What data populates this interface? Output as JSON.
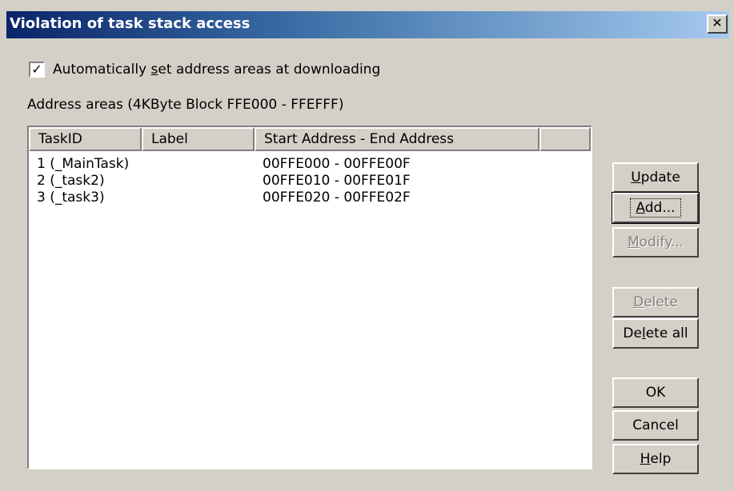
{
  "dialog": {
    "title": "Violation of task stack access",
    "close_glyph": "✕"
  },
  "auto_set": {
    "checked": true,
    "check_glyph": "✓",
    "label_pre": "Automatically ",
    "label_key": "s",
    "label_post": "et address areas at downloading"
  },
  "address_areas_label": "Address areas (4KByte Block  FFE000 - FFEFFF)",
  "table": {
    "columns": [
      "TaskID",
      "Label",
      "Start Address - End Address",
      ""
    ],
    "rows": [
      {
        "task_id": "1 (_MainTask)",
        "label": "",
        "range": "00FFE000 - 00FFE00F"
      },
      {
        "task_id": "2 (_task2)",
        "label": "",
        "range": "00FFE010 - 00FFE01F"
      },
      {
        "task_id": "3 (_task3)",
        "label": "",
        "range": "00FFE020 - 00FFE02F"
      }
    ]
  },
  "buttons": {
    "update": {
      "pre": "",
      "key": "U",
      "post": "pdate",
      "enabled": true
    },
    "add": {
      "pre": "",
      "key": "A",
      "post": "dd...",
      "enabled": true
    },
    "modify": {
      "pre": "",
      "key": "M",
      "post": "odify...",
      "enabled": false
    },
    "delete": {
      "pre": "",
      "key": "D",
      "post": "elete",
      "enabled": false
    },
    "delete_all": {
      "pre": "De",
      "key": "l",
      "post": "ete all",
      "enabled": true
    },
    "ok": {
      "label": "OK",
      "enabled": true
    },
    "cancel": {
      "label": "Cancel",
      "enabled": true
    },
    "help": {
      "pre": "",
      "key": "H",
      "post": "elp",
      "enabled": true
    }
  }
}
